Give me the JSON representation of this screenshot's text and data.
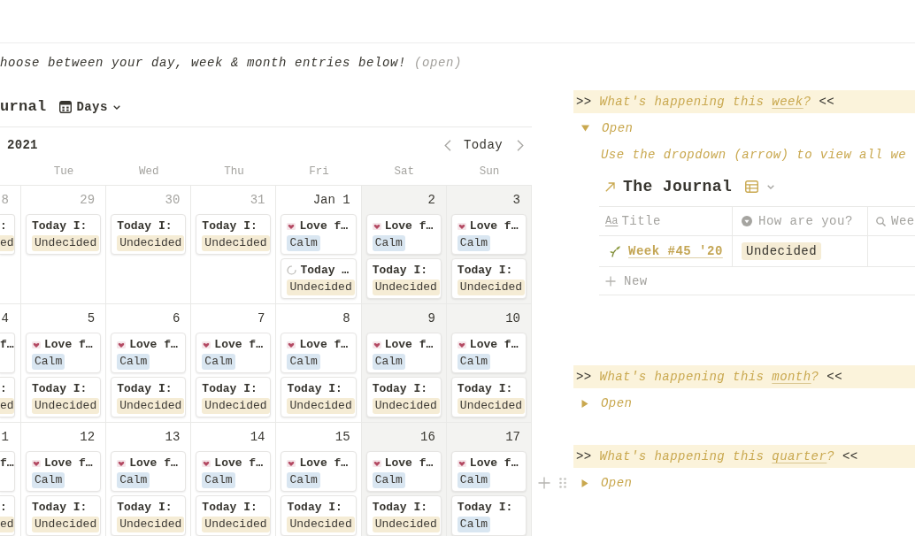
{
  "intro": {
    "text": "hoose between your day, week & month entries below!",
    "note": "(open)"
  },
  "calendar": {
    "title": "urnal",
    "view": "Days",
    "period": "2021",
    "today": "Today",
    "weekdays": [
      "Tue",
      "Wed",
      "Thu",
      "Fri",
      "Sat",
      "Sun"
    ],
    "weeks": [
      {
        "days": [
          {
            "date": "8",
            "other_month": true,
            "weekend": false,
            "cards": [
              {
                "kind": "plain",
                "title": ":",
                "tag": {
                  "label": "ed",
                  "color": "#f5ecd5"
                }
              }
            ]
          },
          {
            "date": "29",
            "other_month": true,
            "weekend": false,
            "cards": [
              {
                "kind": "plain",
                "title": "Today I:",
                "tag": {
                  "label": "Undecided",
                  "color": "#f5ecd5"
                }
              }
            ]
          },
          {
            "date": "30",
            "other_month": true,
            "weekend": false,
            "cards": [
              {
                "kind": "plain",
                "title": "Today I:",
                "tag": {
                  "label": "Undecided",
                  "color": "#f5ecd5"
                }
              }
            ]
          },
          {
            "date": "31",
            "other_month": true,
            "weekend": false,
            "cards": [
              {
                "kind": "plain",
                "title": "Today I:",
                "tag": {
                  "label": "Undecided",
                  "color": "#f5ecd5"
                }
              }
            ]
          },
          {
            "date": "Jan 1",
            "other_month": false,
            "weekend": false,
            "cards": [
              {
                "kind": "heart",
                "title": "Love f…",
                "tag": {
                  "label": "Calm",
                  "color": "#d9e6f1"
                }
              },
              {
                "kind": "loading",
                "title": "Today …",
                "tag": {
                  "label": "Undecided",
                  "color": "#f5ecd5"
                }
              }
            ]
          },
          {
            "date": "2",
            "other_month": false,
            "weekend": true,
            "cards": [
              {
                "kind": "heart",
                "title": "Love f…",
                "tag": {
                  "label": "Calm",
                  "color": "#d9e6f1"
                }
              },
              {
                "kind": "plain",
                "title": "Today I:",
                "tag": {
                  "label": "Undecided",
                  "color": "#f5ecd5"
                }
              }
            ]
          },
          {
            "date": "3",
            "other_month": false,
            "weekend": true,
            "cards": [
              {
                "kind": "heart",
                "title": "Love f…",
                "tag": {
                  "label": "Calm",
                  "color": "#d9e6f1"
                }
              },
              {
                "kind": "plain",
                "title": "Today I:",
                "tag": {
                  "label": "Undecided",
                  "color": "#f5ecd5"
                }
              }
            ]
          }
        ]
      },
      {
        "days": [
          {
            "date": "4",
            "other_month": false,
            "weekend": false,
            "cards": [
              {
                "kind": "plain",
                "title": "f…"
              },
              {
                "kind": "plain",
                "title": ":",
                "tag": {
                  "label": "ed",
                  "color": "#f5ecd5"
                }
              }
            ]
          },
          {
            "date": "5",
            "other_month": false,
            "weekend": false,
            "cards": [
              {
                "kind": "heart",
                "title": "Love f…",
                "tag": {
                  "label": "Calm",
                  "color": "#d9e6f1"
                }
              },
              {
                "kind": "plain",
                "title": "Today I:",
                "tag": {
                  "label": "Undecided",
                  "color": "#f5ecd5"
                }
              }
            ]
          },
          {
            "date": "6",
            "other_month": false,
            "weekend": false,
            "cards": [
              {
                "kind": "heart",
                "title": "Love f…",
                "tag": {
                  "label": "Calm",
                  "color": "#d9e6f1"
                }
              },
              {
                "kind": "plain",
                "title": "Today I:",
                "tag": {
                  "label": "Undecided",
                  "color": "#f5ecd5"
                }
              }
            ]
          },
          {
            "date": "7",
            "other_month": false,
            "weekend": false,
            "cards": [
              {
                "kind": "heart",
                "title": "Love f…",
                "tag": {
                  "label": "Calm",
                  "color": "#d9e6f1"
                }
              },
              {
                "kind": "plain",
                "title": "Today I:",
                "tag": {
                  "label": "Undecided",
                  "color": "#f5ecd5"
                }
              }
            ]
          },
          {
            "date": "8",
            "other_month": false,
            "weekend": false,
            "cards": [
              {
                "kind": "heart",
                "title": "Love f…",
                "tag": {
                  "label": "Calm",
                  "color": "#d9e6f1"
                }
              },
              {
                "kind": "plain",
                "title": "Today I:",
                "tag": {
                  "label": "Undecided",
                  "color": "#f5ecd5"
                }
              }
            ]
          },
          {
            "date": "9",
            "other_month": false,
            "weekend": true,
            "cards": [
              {
                "kind": "heart",
                "title": "Love f…",
                "tag": {
                  "label": "Calm",
                  "color": "#d9e6f1"
                }
              },
              {
                "kind": "plain",
                "title": "Today I:",
                "tag": {
                  "label": "Undecided",
                  "color": "#f5ecd5"
                }
              }
            ]
          },
          {
            "date": "10",
            "other_month": false,
            "weekend": true,
            "cards": [
              {
                "kind": "heart",
                "title": "Love f…",
                "tag": {
                  "label": "Calm",
                  "color": "#d9e6f1"
                }
              },
              {
                "kind": "plain",
                "title": "Today I:",
                "tag": {
                  "label": "Undecided",
                  "color": "#f5ecd5"
                }
              }
            ]
          }
        ]
      },
      {
        "days": [
          {
            "date": "1",
            "other_month": false,
            "weekend": false,
            "cards": [
              {
                "kind": "plain",
                "title": "f…"
              },
              {
                "kind": "plain",
                "title": ":",
                "tag": {
                  "label": "ed",
                  "color": "#f5ecd5"
                }
              }
            ]
          },
          {
            "date": "12",
            "other_month": false,
            "weekend": false,
            "cards": [
              {
                "kind": "heart",
                "title": "Love f…",
                "tag": {
                  "label": "Calm",
                  "color": "#d9e6f1"
                }
              },
              {
                "kind": "plain",
                "title": "Today I:",
                "tag": {
                  "label": "Undecided",
                  "color": "#f5ecd5"
                }
              }
            ]
          },
          {
            "date": "13",
            "other_month": false,
            "weekend": false,
            "cards": [
              {
                "kind": "heart",
                "title": "Love f…",
                "tag": {
                  "label": "Calm",
                  "color": "#d9e6f1"
                }
              },
              {
                "kind": "plain",
                "title": "Today I:",
                "tag": {
                  "label": "Undecided",
                  "color": "#f5ecd5"
                }
              }
            ]
          },
          {
            "date": "14",
            "other_month": false,
            "weekend": false,
            "cards": [
              {
                "kind": "heart",
                "title": "Love f…",
                "tag": {
                  "label": "Calm",
                  "color": "#d9e6f1"
                }
              },
              {
                "kind": "plain",
                "title": "Today I:",
                "tag": {
                  "label": "Undecided",
                  "color": "#f5ecd5"
                }
              }
            ]
          },
          {
            "date": "15",
            "other_month": false,
            "weekend": false,
            "cards": [
              {
                "kind": "heart",
                "title": "Love f…",
                "tag": {
                  "label": "Calm",
                  "color": "#d9e6f1"
                }
              },
              {
                "kind": "plain",
                "title": "Today I:",
                "tag": {
                  "label": "Undecided",
                  "color": "#f5ecd5"
                }
              }
            ]
          },
          {
            "date": "16",
            "other_month": false,
            "weekend": true,
            "cards": [
              {
                "kind": "heart",
                "title": "Love f…",
                "tag": {
                  "label": "Calm",
                  "color": "#d9e6f1"
                }
              },
              {
                "kind": "plain",
                "title": "Today I:",
                "tag": {
                  "label": "Undecided",
                  "color": "#f5ecd5"
                }
              }
            ]
          },
          {
            "date": "17",
            "other_month": false,
            "weekend": true,
            "cards": [
              {
                "kind": "heart",
                "title": "Love f…",
                "tag": {
                  "label": "Calm",
                  "color": "#d9e6f1"
                }
              },
              {
                "kind": "plain",
                "title": "Today I:",
                "tag": {
                  "label": "Calm",
                  "color": "#d9e6f1"
                }
              }
            ]
          }
        ]
      }
    ]
  },
  "sections": [
    {
      "prefix": ">>",
      "text": "What's happening this",
      "link": "week",
      "after": "?",
      "suffix": "<<",
      "hovered": false,
      "toggle": {
        "expanded": true,
        "label": "Open"
      },
      "hint": "Use the dropdown (arrow) to view all we",
      "database": {
        "title": "The Journal",
        "columns": [
          {
            "kind": "title",
            "type_label": "Aa",
            "label": "Title"
          },
          {
            "kind": "select",
            "label": "How are you?"
          },
          {
            "kind": "search",
            "label": "Wee"
          }
        ],
        "rows": [
          {
            "title": "Week #45 '20",
            "tag": {
              "label": "Undecided",
              "color": "#f5ecd5"
            }
          }
        ],
        "new_label": "New"
      }
    },
    {
      "prefix": ">>",
      "text": "What's happening this",
      "link": "month",
      "after": "?",
      "suffix": "<<",
      "hovered": false,
      "toggle": {
        "expanded": false,
        "label": "Open"
      }
    },
    {
      "prefix": ">>",
      "text": "What's happening this",
      "link": "quarter",
      "after": "?",
      "suffix": "<<",
      "hovered": true,
      "toggle": {
        "expanded": false,
        "label": "Open"
      }
    }
  ]
}
